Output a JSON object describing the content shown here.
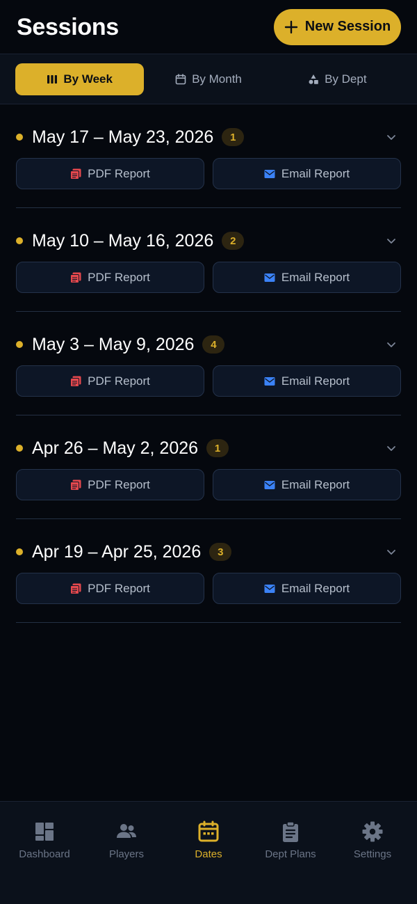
{
  "header": {
    "title": "Sessions",
    "new_button_label": "New Session"
  },
  "view_tabs": [
    {
      "label": "By Week",
      "icon": "columns-icon",
      "active": true
    },
    {
      "label": "By Month",
      "icon": "calendar-icon",
      "active": false
    },
    {
      "label": "By Dept",
      "icon": "shapes-icon",
      "active": false
    }
  ],
  "weeks": [
    {
      "range": "May 17 – May 23, 2026",
      "count": "1",
      "pdf_label": "PDF Report",
      "email_label": "Email Report"
    },
    {
      "range": "May 10 – May 16, 2026",
      "count": "2",
      "pdf_label": "PDF Report",
      "email_label": "Email Report"
    },
    {
      "range": "May 3 – May 9, 2026",
      "count": "4",
      "pdf_label": "PDF Report",
      "email_label": "Email Report"
    },
    {
      "range": "Apr 26 – May 2, 2026",
      "count": "1",
      "pdf_label": "PDF Report",
      "email_label": "Email Report"
    },
    {
      "range": "Apr 19 – Apr 25, 2026",
      "count": "3",
      "pdf_label": "PDF Report",
      "email_label": "Email Report"
    }
  ],
  "bottom_nav": [
    {
      "label": "Dashboard",
      "icon": "dashboard-icon",
      "active": false
    },
    {
      "label": "Players",
      "icon": "people-icon",
      "active": false
    },
    {
      "label": "Dates",
      "icon": "calendar-icon",
      "active": true
    },
    {
      "label": "Dept Plans",
      "icon": "clipboard-icon",
      "active": false
    },
    {
      "label": "Settings",
      "icon": "gear-icon",
      "active": false
    }
  ],
  "colors": {
    "accent": "#dcb02a",
    "background": "#05080e",
    "panel": "#0b111b",
    "pdf_icon": "#e5484d",
    "email_icon": "#3b82f6"
  }
}
